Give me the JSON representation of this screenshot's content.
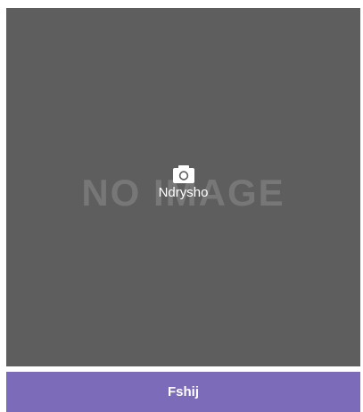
{
  "image_placeholder": {
    "text": "NO IMAGE",
    "background_color": "#5e5e5e",
    "text_color": "#777777"
  },
  "change_control": {
    "icon": "camera-icon",
    "label": "Ndrysho"
  },
  "delete_button": {
    "label": "Fshij",
    "color": "#7b6bb8"
  }
}
